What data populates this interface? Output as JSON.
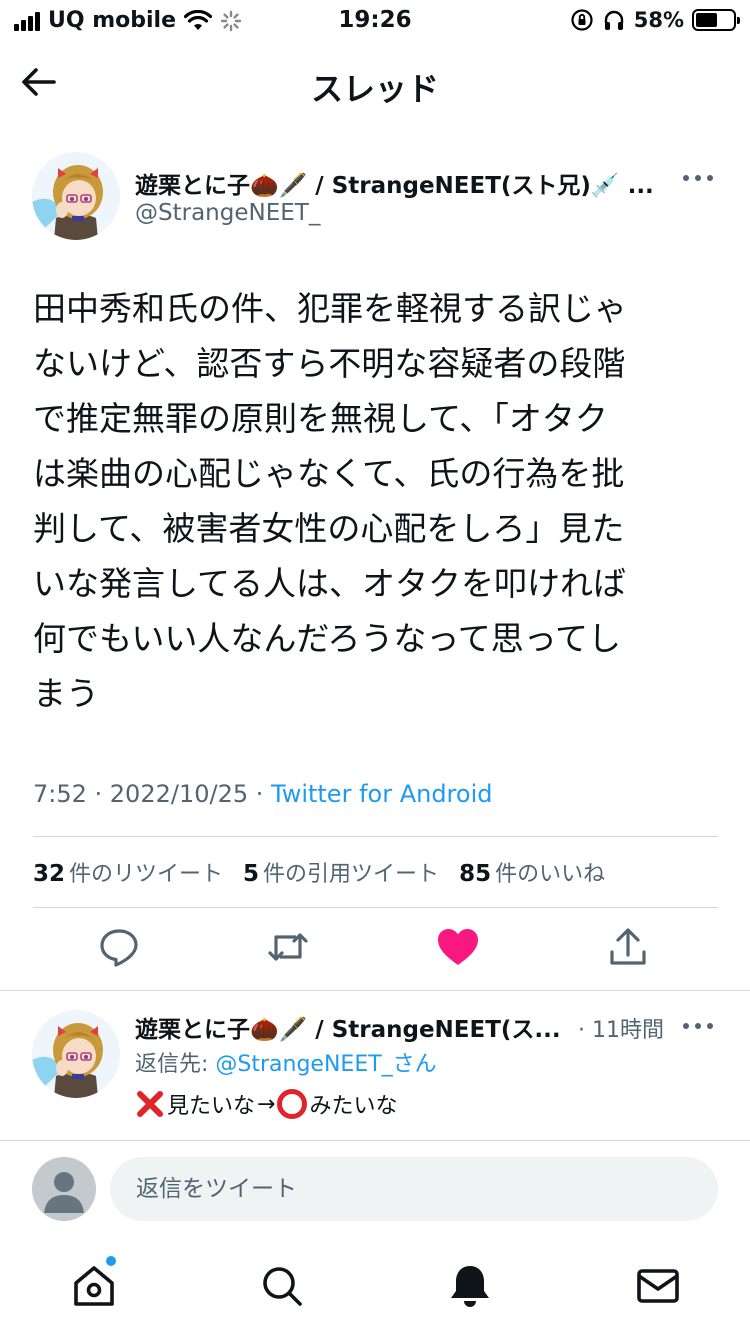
{
  "status_bar": {
    "carrier": "UQ mobile",
    "time": "19:26",
    "battery": "58%",
    "battery_level": 0.58
  },
  "header": {
    "title": "スレッド"
  },
  "tweet": {
    "author_name": "遊栗とに子🌰🖋️ / StrangeNEET(スト兄)💉 ...",
    "author_handle": "@StrangeNEET_",
    "text": "田中秀和氏の件、犯罪を軽視する訳じゃ\nないけど、認否すら不明な容疑者の段階\nで推定無罪の原則を無視して、「オタク\nは楽曲の心配じゃなくて、氏の行為を批\n判して、被害者女性の心配をしろ」見た\nいな発言してる人は、オタクを叩ければ\n何でもいい人なんだろうなって思ってし\nまう",
    "time": "7:52 · 2022/10/25 · ",
    "source": "Twitter for Android",
    "retweets": "32",
    "retweets_label": "件のリツイート",
    "quotes": "5",
    "quotes_label": "件の引用ツイート",
    "likes": "85",
    "likes_label": "件のいいね",
    "liked": true
  },
  "reply": {
    "author_name": "遊栗とに子🌰🖋️ / StrangeNEET(ス...",
    "time": "· 11時間",
    "reply_to_label": "返信先: ",
    "reply_to_mention": "@StrangeNEET_さん",
    "text_part1": "見たいな",
    "arrow": "→",
    "text_part2": "みたいな"
  },
  "composer": {
    "placeholder": "返信をツイート"
  },
  "colors": {
    "accent": "#1d9bf0",
    "like": "#f91880",
    "secondary_text": "#536471"
  },
  "icons": [
    "back-arrow-icon",
    "more-icon",
    "reply-icon",
    "retweet-icon",
    "like-icon",
    "share-icon",
    "home-icon",
    "search-icon",
    "notifications-icon",
    "messages-icon"
  ]
}
